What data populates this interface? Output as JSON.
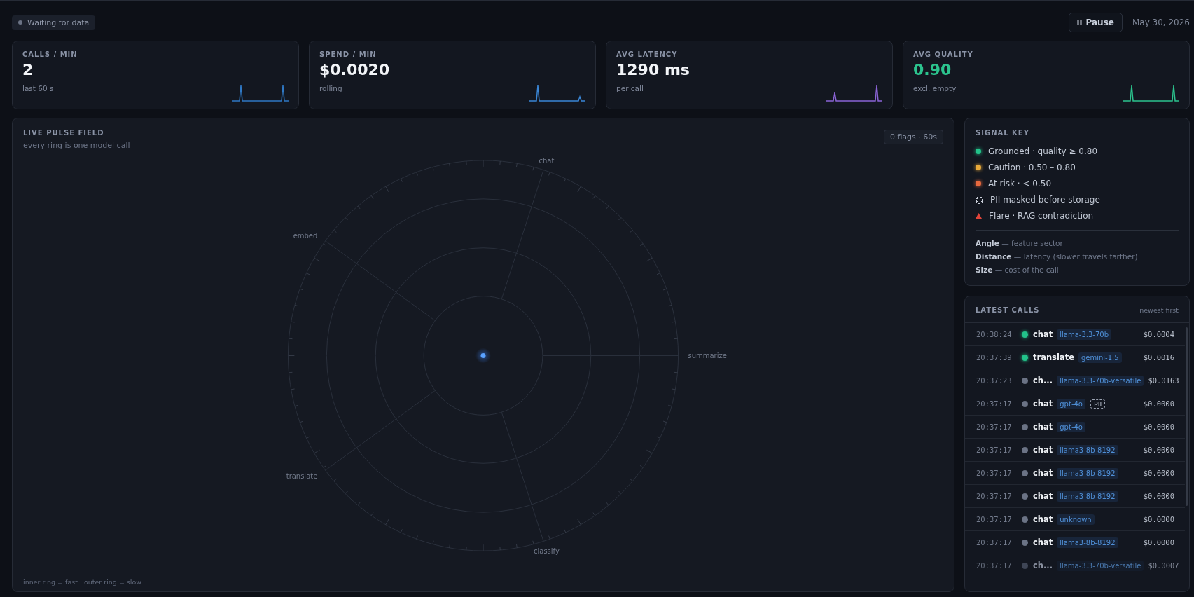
{
  "status": {
    "label": "Waiting for data"
  },
  "header": {
    "pause_button": "Pause",
    "date": "May 30, 2026"
  },
  "stats": [
    {
      "label": "CALLS / MIN",
      "value": "2",
      "sub": "last 60 s",
      "color": "#2f78c4",
      "highlighted": false
    },
    {
      "label": "SPEND / MIN",
      "value": "$0.0020",
      "sub": "rolling",
      "color": "#3a86d6",
      "highlighted": false
    },
    {
      "label": "AVG LATENCY",
      "value": "1290 ms",
      "sub": "per call",
      "color": "#8b64d6",
      "highlighted": false
    },
    {
      "label": "AVG QUALITY",
      "value": "0.90",
      "sub": "excl. empty",
      "color": "#2cc48e",
      "highlighted": true
    }
  ],
  "pulse_field": {
    "title": "LIVE PULSE FIELD",
    "subtitle": "every ring is one model call",
    "flags_badge": "0 flags · 60s",
    "footer": "inner ring = fast · outer ring = slow",
    "sectors": [
      "chat",
      "summarize",
      "classify",
      "translate",
      "embed"
    ]
  },
  "signal_key": {
    "title": "SIGNAL KEY",
    "items": [
      {
        "kind": "dot",
        "color": "#22c38a",
        "label": "Grounded · quality ≥ 0.80"
      },
      {
        "kind": "dot",
        "color": "#e8a93a",
        "label": "Caution · 0.50 – 0.80"
      },
      {
        "kind": "dot",
        "color": "#e8693e",
        "label": "At risk · < 0.50"
      },
      {
        "kind": "dashed",
        "color": "#c9ced8",
        "label": "PII masked before storage"
      },
      {
        "kind": "triangle",
        "color": "#e0443a",
        "label": "Flare · RAG contradiction"
      }
    ],
    "notes": [
      {
        "term": "Angle",
        "text": "— feature sector"
      },
      {
        "term": "Distance",
        "text": "— latency (slower travels farther)"
      },
      {
        "term": "Size",
        "text": "— cost of the call"
      }
    ]
  },
  "latest_calls": {
    "title": "LATEST CALLS",
    "order": "newest first",
    "rows": [
      {
        "time": "20:38:24",
        "color": "#22c38a",
        "feature": "chat",
        "model": "llama-3.3-70b",
        "pii": false,
        "cost": "$0.0004",
        "faded": false
      },
      {
        "time": "20:37:39",
        "color": "#22c38a",
        "feature": "translate",
        "model": "gemini-1.5",
        "pii": false,
        "cost": "$0.0016",
        "faded": false
      },
      {
        "time": "20:37:23",
        "color": "#6b7385",
        "feature": "ch...",
        "model": "llama-3.3-70b-versatile",
        "pii": false,
        "cost": "$0.0163",
        "faded": false
      },
      {
        "time": "20:37:17",
        "color": "#6b7385",
        "feature": "chat",
        "model": "gpt-4o",
        "pii": true,
        "pii_label": "PII",
        "cost": "$0.0000",
        "faded": false
      },
      {
        "time": "20:37:17",
        "color": "#6b7385",
        "feature": "chat",
        "model": "gpt-4o",
        "pii": false,
        "cost": "$0.0000",
        "faded": false
      },
      {
        "time": "20:37:17",
        "color": "#6b7385",
        "feature": "chat",
        "model": "llama3-8b-8192",
        "pii": false,
        "cost": "$0.0000",
        "faded": false
      },
      {
        "time": "20:37:17",
        "color": "#6b7385",
        "feature": "chat",
        "model": "llama3-8b-8192",
        "pii": false,
        "cost": "$0.0000",
        "faded": false
      },
      {
        "time": "20:37:17",
        "color": "#6b7385",
        "feature": "chat",
        "model": "llama3-8b-8192",
        "pii": false,
        "cost": "$0.0000",
        "faded": false
      },
      {
        "time": "20:37:17",
        "color": "#6b7385",
        "feature": "chat",
        "model": "unknown",
        "pii": false,
        "cost": "$0.0000",
        "faded": false
      },
      {
        "time": "20:37:17",
        "color": "#6b7385",
        "feature": "chat",
        "model": "llama3-8b-8192",
        "pii": false,
        "cost": "$0.0000",
        "faded": false
      },
      {
        "time": "20:37:17",
        "color": "#3f4656",
        "feature": "ch...",
        "model": "llama-3.3-70b-versatile",
        "pii": false,
        "cost": "$0.0007",
        "faded": true
      }
    ]
  }
}
